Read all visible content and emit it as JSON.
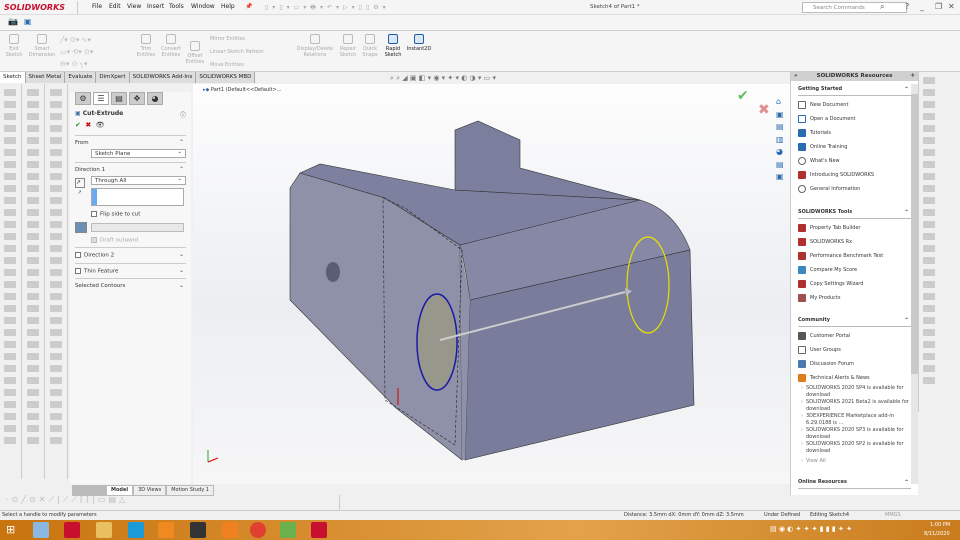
{
  "app": {
    "logo": "SOLIDWORKS",
    "title": "Sketch4 of Part1 *",
    "search_placeholder": "Search Commands"
  },
  "menu": [
    "File",
    "Edit",
    "View",
    "Insert",
    "Tools",
    "Window",
    "Help"
  ],
  "ribbon": {
    "buttons": [
      {
        "label": "Exit Sketch",
        "enabled": false
      },
      {
        "label": "Smart Dimension",
        "enabled": false
      },
      {
        "label": "Trim Entities",
        "enabled": false
      },
      {
        "label": "Convert Entities",
        "enabled": false
      },
      {
        "label": "Offset Entities",
        "enabled": false
      },
      {
        "label": "Display/Delete Relations",
        "enabled": false
      },
      {
        "label": "Repair Sketch",
        "enabled": false
      },
      {
        "label": "Quick Snaps",
        "enabled": false
      },
      {
        "label": "Rapid Sketch",
        "enabled": true
      },
      {
        "label": "Instant2D",
        "enabled": true
      }
    ],
    "small": [
      "Mirror Entities",
      "Linear Sketch Pattern",
      "Move Entities"
    ]
  },
  "tabs": [
    "Sketch",
    "Sheet Metal",
    "Evaluate",
    "DimXpert",
    "SOLIDWORKS Add-Ins",
    "SOLIDWORKS MBD"
  ],
  "tree": {
    "item": "Part1 (Default<<Default>..."
  },
  "property_manager": {
    "title": "Cut-Extrude",
    "from_label": "From",
    "from_value": "Sketch Plane",
    "direction1_label": "Direction 1",
    "end_condition": "Through All",
    "flip_label": "Flip side to cut",
    "draft_label": "Draft outward",
    "direction2_label": "Direction 2",
    "thin_label": "Thin Feature",
    "contours_label": "Selected Contours"
  },
  "resources": {
    "title": "SOLIDWORKS Resources",
    "getting_started": {
      "title": "Getting Started",
      "items": [
        "New Document",
        "Open a Document",
        "Tutorials",
        "Online Training",
        "What's New",
        "Introducing SOLIDWORKS",
        "General Information"
      ]
    },
    "tools": {
      "title": "SOLIDWORKS Tools",
      "items": [
        "Property Tab Builder",
        "SOLIDWORKS Rx",
        "Performance Benchmark Test",
        "Compare My Score",
        "Copy Settings Wizard",
        "My Products"
      ]
    },
    "community": {
      "title": "Community",
      "items": [
        "Customer Portal",
        "User Groups",
        "Discussion Forum",
        "Technical Alerts & News"
      ],
      "news": [
        "SOLIDWORKS 2020 SP4 is available for download",
        "SOLIDWORKS 2021 Beta2 is available for download",
        "3DEXPERIENCE Marketplace add-in 6.29.0188 is ...",
        "SOLIDWORKS 2020 SP3 is available for download",
        "SOLIDWORKS 2020 SP2 is available for download"
      ],
      "view_all": "View All"
    },
    "online": {
      "title": "Online Resources"
    }
  },
  "bottom_tabs": [
    "Model",
    "3D Views",
    "Motion Study 1"
  ],
  "status": {
    "hint": "Select a handle to modify parameters",
    "distance": "Distance: 3.5mm  dX: 0mm  dY: 0mm  dZ: 3.5mm",
    "state": "Under Defined",
    "editing": "Editing Sketch4",
    "units": "MMGS"
  },
  "taskbar": {
    "time": "1:00 PM",
    "date": "8/11/2020"
  },
  "colors": {
    "model": "#8e90a6",
    "contour": "#1a1aa8",
    "yellow": "#e8e000",
    "brand": "#c8102e"
  }
}
